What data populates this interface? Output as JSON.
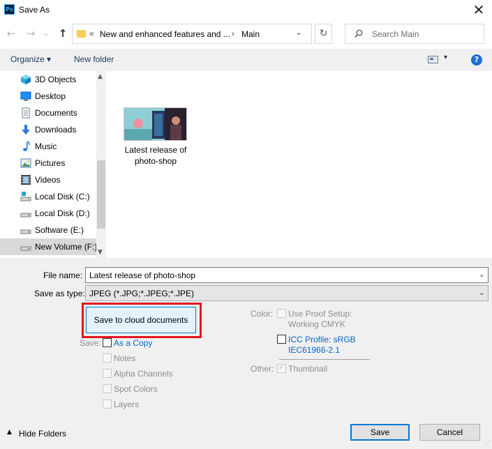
{
  "window": {
    "title": "Save As",
    "app_logo": "Ps",
    "close_glyph": "✕"
  },
  "nav": {
    "back": "←",
    "forward": "→",
    "recent": "⌄",
    "up": "↑",
    "refresh": "↻"
  },
  "address": {
    "sep": "«",
    "crumb1": "New and enhanced features and ...",
    "arrow": "›",
    "crumb2": "Main",
    "dropdown": "⌄"
  },
  "search": {
    "placeholder": "Search Main"
  },
  "toolbar": {
    "organize": "Organize ▾",
    "new_folder": "New folder",
    "view_dropdown": "▾",
    "help": "?"
  },
  "sidebar": {
    "items": [
      {
        "label": "3D Objects",
        "icon": "3d-objects-icon"
      },
      {
        "label": "Desktop",
        "icon": "desktop-icon"
      },
      {
        "label": "Documents",
        "icon": "documents-icon"
      },
      {
        "label": "Downloads",
        "icon": "downloads-icon"
      },
      {
        "label": "Music",
        "icon": "music-icon"
      },
      {
        "label": "Pictures",
        "icon": "pictures-icon"
      },
      {
        "label": "Videos",
        "icon": "videos-icon"
      },
      {
        "label": "Local Disk (C:)",
        "icon": "local-disk-icon"
      },
      {
        "label": "Local Disk (D:)",
        "icon": "local-disk-icon"
      },
      {
        "label": "Software (E:)",
        "icon": "drive-icon"
      },
      {
        "label": "New Volume (F:)",
        "icon": "drive-icon",
        "selected": true
      }
    ],
    "scroll_up": "▲",
    "scroll_down": "▼"
  },
  "files": [
    {
      "name_line1": "Latest release of",
      "name_line2": "photo-shop"
    }
  ],
  "form": {
    "file_name_label": "File name:",
    "file_name_value": "Latest release of photo-shop",
    "save_type_label": "Save as type:",
    "save_type_value": "JPEG (*.JPG;*.JPEG;*.JPE)",
    "dropdown": "⌄"
  },
  "options": {
    "cloud_button": "Save to cloud documents",
    "save_label": "Save:",
    "as_copy": "As a Copy",
    "notes": "Notes",
    "alpha_channels": "Alpha Channels",
    "spot_colors": "Spot Colors",
    "layers": "Layers",
    "color_label": "Color:",
    "use_proof_line1": "Use Proof Setup:",
    "use_proof_line2": "Working CMYK",
    "icc_line1": "ICC Profile:  sRGB",
    "icc_line2": "IEC61966-2.1",
    "other_label": "Other:",
    "thumbnail": "Thumbnail",
    "check": "✓"
  },
  "footer": {
    "hide_arrow": "▲",
    "hide_folders": "Hide Folders",
    "save": "Save",
    "cancel": "Cancel"
  }
}
